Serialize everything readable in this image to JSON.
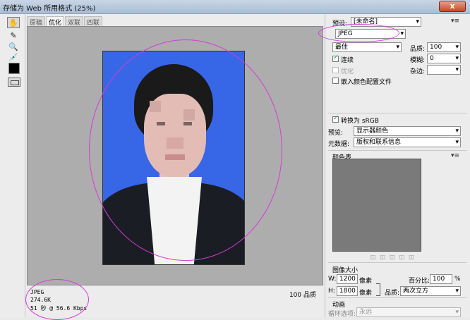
{
  "window": {
    "title": "存储为 Web 所用格式 (25%)",
    "close_label": "x"
  },
  "tools": {
    "hand": "✋",
    "slice": "✎",
    "zoom": "🔍",
    "eyedropper": "💉"
  },
  "tabs": [
    {
      "label": "原稿"
    },
    {
      "label": "优化"
    },
    {
      "label": "双联"
    },
    {
      "label": "四联"
    }
  ],
  "info": {
    "format": "JPEG",
    "size": "274.6K",
    "speed": "51 秒 @ 56.6 Kbps",
    "quality_label": "100 品质",
    "speed_menu": "▾≡"
  },
  "panel": {
    "preset_label": "预设:",
    "preset_value": "[未命名]",
    "format_value": "JPEG",
    "quality_level": "最佳",
    "quality_label": "品质:",
    "quality_value": "100",
    "progressive_label": "连续",
    "blur_label": "模糊:",
    "blur_value": "0",
    "optimized_label": "优化",
    "matte_label": "杂边:",
    "matte_value": "",
    "embed_profile_label": "嵌入颜色配置文件",
    "convert_srgb_label": "转换为 sRGB",
    "preview_label": "预览:",
    "preview_value": "显示器颜色",
    "metadata_label": "元数据:",
    "metadata_value": "版权和联系信息",
    "color_table_label": "颜色表",
    "image_size_label": "图像大小",
    "width_label": "W:",
    "width_value": "1200",
    "width_unit": "像素",
    "height_label": "H:",
    "height_value": "1800",
    "height_unit": "像素",
    "percent_label": "百分比:",
    "percent_value": "100",
    "percent_unit": "%",
    "resample_label": "品质:",
    "resample_value": "两次立方",
    "animation_label": "动画",
    "loop_label": "循环选项:",
    "loop_value": "永远"
  }
}
